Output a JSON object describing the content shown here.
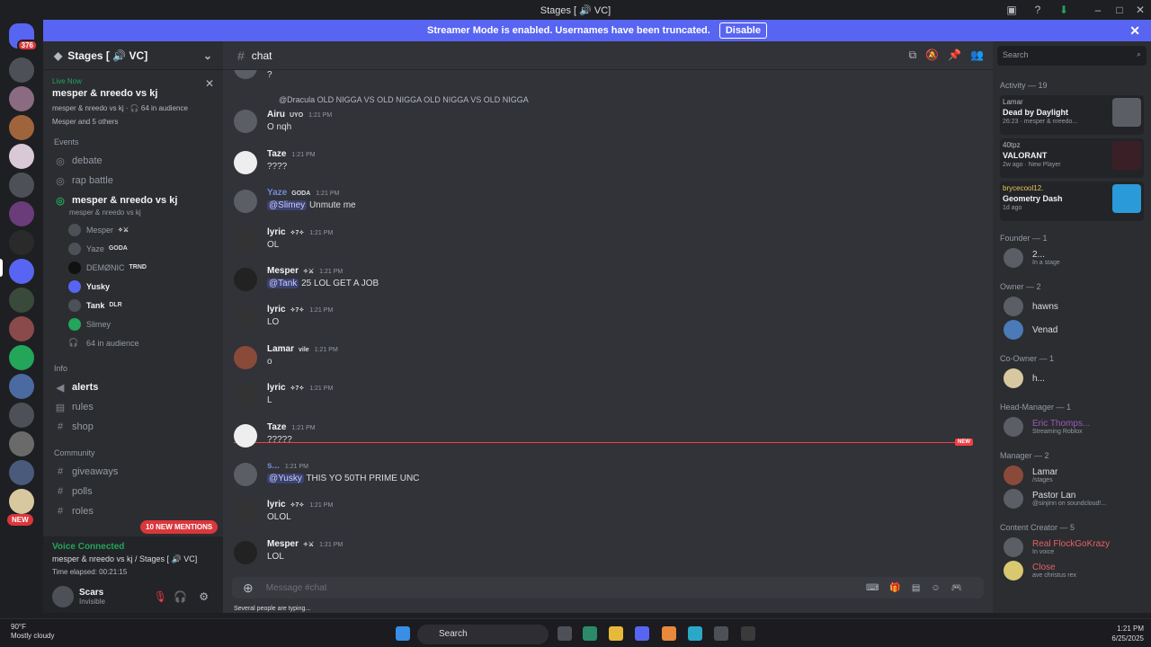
{
  "window": {
    "title": "Stages [ 🔊 VC]"
  },
  "banner": {
    "text": "Streamer Mode is enabled. Usernames have been truncated.",
    "button": "Disable"
  },
  "guilds": {
    "badge_top": "376",
    "new_label": "NEW"
  },
  "server": {
    "name": "Stages [ 🔊 VC]"
  },
  "live": {
    "label": "Live Now",
    "title": "mesper & nreedo vs kj",
    "meta": "mesper & nreedo vs kj · 🎧 64 in audience",
    "others": "Mesper and 5 others"
  },
  "sidebar": {
    "events_cat": "Events",
    "debate": "debate",
    "rap": "rap battle",
    "stage_name": "mesper & nreedo vs kj",
    "stage_sub": "mesper & nreedo vs kj",
    "members": [
      {
        "name": "Mesper",
        "tag": "✧⚔"
      },
      {
        "name": "Yaze",
        "tag": "GODA"
      },
      {
        "name": "DEMØNIC",
        "tag": "TRND"
      },
      {
        "name": "Yusky",
        "tag": ""
      },
      {
        "name": "Tank",
        "tag": "DLR"
      },
      {
        "name": "Slimey",
        "tag": ""
      }
    ],
    "audience": "64 in audience",
    "info_cat": "Info",
    "alerts": "alerts",
    "rules": "rules",
    "shop": "shop",
    "community_cat": "Community",
    "giveaways": "giveaways",
    "polls": "polls",
    "roles": "roles",
    "new_mentions": "10 NEW MENTIONS"
  },
  "voice": {
    "status": "Voice Connected",
    "channel": "mesper & nreedo vs kj / Stages [ 🔊 VC]",
    "elapsed": "Time elapsed: 00:21:15"
  },
  "user": {
    "name": "Scars",
    "status": "Invisible"
  },
  "channel": {
    "name": "chat"
  },
  "messages": [
    {
      "user": "",
      "time": "",
      "text": "?"
    },
    {
      "user": "Airu",
      "time": "1:21 PM",
      "reply": "@Dracula OLD NIGGA VS OLD NIGGA    OLD NIGGA VS OLD NIGGA",
      "tag": "UYO",
      "text": "O nqh"
    },
    {
      "user": "Taze",
      "time": "1:21 PM",
      "text": "????"
    },
    {
      "user": "Yaze",
      "time": "1:21 PM",
      "tag": "GODA",
      "mention": "@Slimey",
      "text": "Unmute me"
    },
    {
      "user": "lyric",
      "time": "1:21 PM",
      "tag": "✧7✧",
      "text": "OL"
    },
    {
      "user": "Mesper",
      "time": "1:21 PM",
      "tag": "✧⚔",
      "mention": "@Tank",
      "text": "25 LOL GET A JOB"
    },
    {
      "user": "lyric",
      "time": "1:21 PM",
      "tag": "✧7✧",
      "text": "LO"
    },
    {
      "user": "Lamar",
      "time": "1:21 PM",
      "tag": "vile",
      "text": "o"
    },
    {
      "user": "lyric",
      "time": "1:21 PM",
      "tag": "✧7✧",
      "text": "L"
    },
    {
      "user": "Taze",
      "time": "1:21 PM",
      "text": "?????"
    },
    {
      "user": "s...",
      "time": "1:21 PM",
      "mention": "@Yusky",
      "text": "THIS YO 50TH PRIME UNC"
    },
    {
      "user": "lyric",
      "time": "1:21 PM",
      "tag": "✧7✧",
      "text": "OLOL"
    },
    {
      "user": "Mesper",
      "time": "1:21 PM",
      "tag": "✧⚔",
      "text": "LOL"
    }
  ],
  "new_label": "NEW",
  "composer": {
    "placeholder": "Message #chat",
    "typing": "Several people are typing..."
  },
  "search": {
    "placeholder": "Search"
  },
  "activity": {
    "header": "Activity — 19",
    "cards": [
      {
        "user": "Lamar",
        "game": "Dead by Daylight",
        "meta": "26:23 · mesper & nreedo..."
      },
      {
        "user": "40tpz",
        "game": "VALORANT",
        "meta": "2w ago · New Player"
      },
      {
        "user": "brycecool12.",
        "game": "Geometry Dash",
        "meta": "1d ago"
      }
    ]
  },
  "roles": [
    {
      "name": "Founder — 1",
      "members": [
        {
          "n": "2...",
          "s": "In a stage"
        }
      ]
    },
    {
      "name": "Owner — 2",
      "members": [
        {
          "n": "hawns",
          "s": ""
        },
        {
          "n": "Venad",
          "s": ""
        }
      ]
    },
    {
      "name": "Co-Owner — 1",
      "members": [
        {
          "n": "h...",
          "s": ""
        }
      ]
    },
    {
      "name": "Head-Manager — 1",
      "members": [
        {
          "n": "Eric Thomps...",
          "s": "Streaming Roblox"
        }
      ]
    },
    {
      "name": "Manager — 2",
      "members": [
        {
          "n": "Lamar",
          "s": "/stages"
        },
        {
          "n": "Pastor Lan",
          "s": "@sinjinn on soundcloud!..."
        }
      ]
    },
    {
      "name": "Content Creator — 5",
      "members": [
        {
          "n": "Real FlockGoKrazy",
          "s": "In voice"
        },
        {
          "n": "Close",
          "s": "ave christus rex"
        }
      ]
    }
  ],
  "taskbar": {
    "temp": "90°F",
    "weather": "Mostly cloudy",
    "search": "Search",
    "time": "1:21 PM",
    "date": "6/25/2025"
  }
}
